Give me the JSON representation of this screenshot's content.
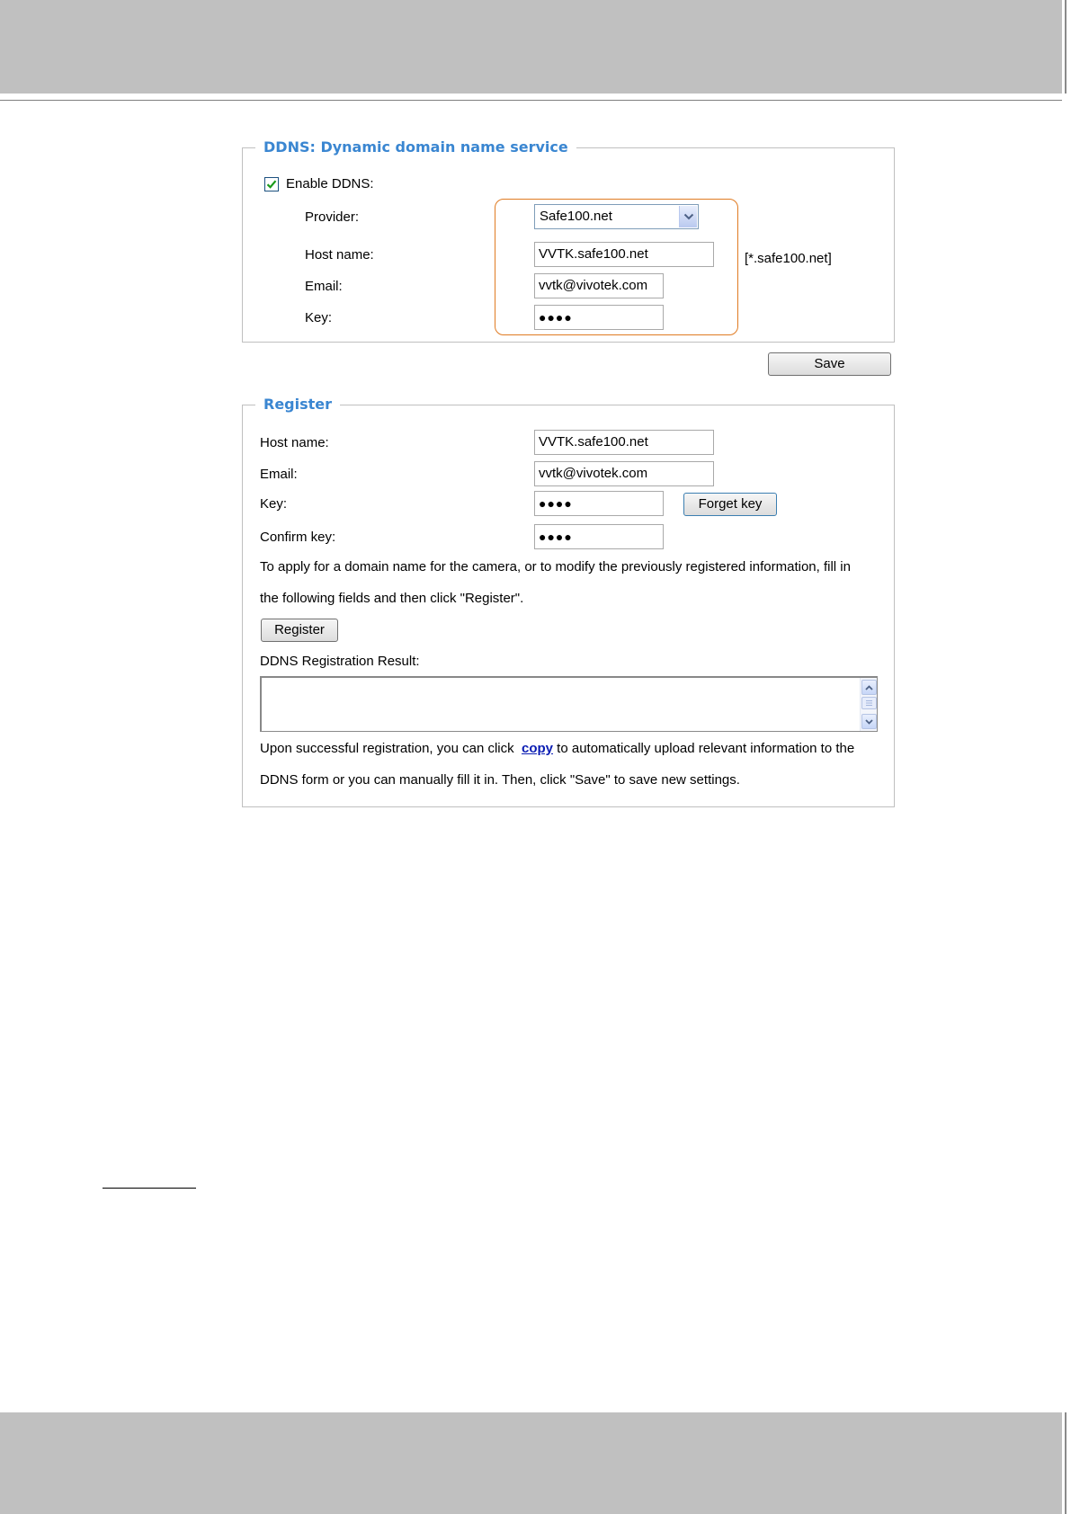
{
  "ddns": {
    "legend": "DDNS: Dynamic domain name service",
    "enable_label": "Enable DDNS:",
    "enable_checked": true,
    "provider_label": "Provider:",
    "provider_value": "Safe100.net",
    "host_label": "Host name:",
    "host_value": "VVTK.safe100.net",
    "host_hint": "[*.safe100.net]",
    "email_label": "Email:",
    "email_value": "vvtk@vivotek.com",
    "key_label": "Key:",
    "key_value": "●●●●",
    "highlight_color": "#e07b22"
  },
  "save_label": "Save",
  "register": {
    "legend": "Register",
    "host_label": "Host name:",
    "host_value": "VVTK.safe100.net",
    "email_label": "Email:",
    "email_value": "vvtk@vivotek.com",
    "key_label": "Key:",
    "key_value": "●●●●",
    "forget_key_label": "Forget key",
    "confirm_label": "Confirm key:",
    "confirm_value": "●●●●",
    "instruction_line1": "To apply for a domain name for the camera, or to modify the previously registered information, fill in",
    "instruction_line2": "the following fields and then click \"Register\".",
    "register_label": "Register",
    "result_label": "DDNS Registration Result:",
    "result_value": "",
    "after_line1_pre": "Upon successful registration, you can click",
    "copy_link": "copy",
    "after_line1_post": "to automatically upload relevant information to the",
    "after_line2": "DDNS form or you can manually fill it in. Then, click \"Save\" to save new settings."
  },
  "colors": {
    "legend": "#3a86d1",
    "link": "#0b1db3",
    "band": "#c0c0c0"
  }
}
